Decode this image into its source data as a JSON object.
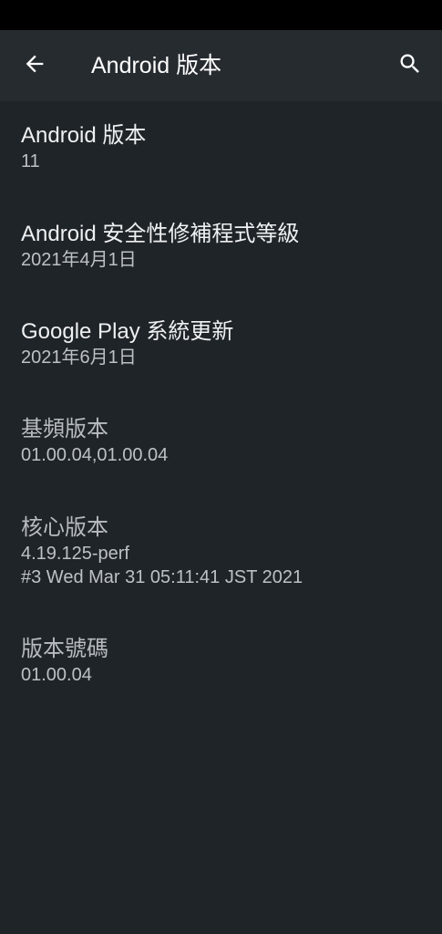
{
  "app_bar": {
    "title": "Android 版本",
    "back_icon": "arrow-back-icon",
    "search_icon": "search-icon"
  },
  "items": [
    {
      "title": "Android 版本",
      "summary": "11",
      "enabled": true
    },
    {
      "title": "Android 安全性修補程式等級",
      "summary": "2021年4月1日",
      "enabled": true
    },
    {
      "title": "Google Play 系統更新",
      "summary": "2021年6月1日",
      "enabled": true
    },
    {
      "title": "基頻版本",
      "summary": "01.00.04,01.00.04",
      "enabled": false
    },
    {
      "title": "核心版本",
      "summary_lines": [
        "4.19.125-perf",
        "#3 Wed Mar 31 05:11:41 JST 2021"
      ],
      "enabled": false
    },
    {
      "title": "版本號碼",
      "summary": "01.00.04",
      "enabled": false
    }
  ],
  "colors": {
    "background": "#1f2428",
    "app_bar": "#262b30",
    "status_bar": "#000000",
    "title_text": "#ffffff",
    "summary_text": "#bdc1c6"
  }
}
